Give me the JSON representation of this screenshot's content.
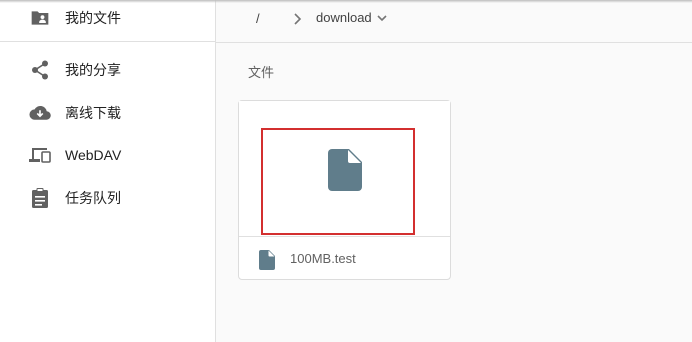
{
  "sidebar": {
    "items": [
      {
        "label": "我的文件",
        "icon": "folder-account-icon"
      },
      {
        "label": "我的分享",
        "icon": "share-icon"
      },
      {
        "label": "离线下载",
        "icon": "cloud-download-icon"
      },
      {
        "label": "WebDAV",
        "icon": "devices-icon"
      },
      {
        "label": "任务队列",
        "icon": "clipboard-icon"
      }
    ]
  },
  "breadcrumb": {
    "root": "/",
    "current": "download"
  },
  "main": {
    "section_title": "文件",
    "files": [
      {
        "name": "100MB.test",
        "icon": "file-icon"
      }
    ]
  },
  "colors": {
    "icon": "#607d8b",
    "sidebar_icon": "#616161",
    "highlight": "#d32f2f"
  }
}
